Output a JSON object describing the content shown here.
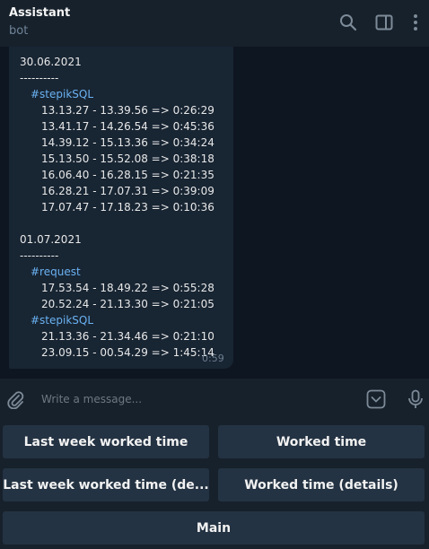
{
  "header": {
    "title": "Assistant",
    "status": "bot",
    "icons": [
      "search-icon",
      "sidebar-toggle-icon",
      "more-vertical-icon"
    ]
  },
  "message": {
    "lines": [
      {
        "text": "30.06.2021",
        "indent": 0,
        "tag": false
      },
      {
        "text": "----------",
        "indent": 0,
        "tag": false
      },
      {
        "text": "#stepikSQL",
        "indent": 1,
        "tag": true
      },
      {
        "text": "13.13.27 - 13.39.56 => 0:26:29",
        "indent": 2,
        "tag": false
      },
      {
        "text": "13.41.17 - 14.26.54 => 0:45:36",
        "indent": 2,
        "tag": false
      },
      {
        "text": "14.39.12 - 15.13.36 => 0:34:24",
        "indent": 2,
        "tag": false
      },
      {
        "text": "15.13.50 - 15.52.08 => 0:38:18",
        "indent": 2,
        "tag": false
      },
      {
        "text": "16.06.40 - 16.28.15 => 0:21:35",
        "indent": 2,
        "tag": false
      },
      {
        "text": "16.28.21 - 17.07.31 => 0:39:09",
        "indent": 2,
        "tag": false
      },
      {
        "text": "17.07.47 - 17.18.23 => 0:10:36",
        "indent": 2,
        "tag": false
      },
      {
        "text": "",
        "indent": 0,
        "tag": false
      },
      {
        "text": "01.07.2021",
        "indent": 0,
        "tag": false
      },
      {
        "text": "----------",
        "indent": 0,
        "tag": false
      },
      {
        "text": "#request",
        "indent": 1,
        "tag": true
      },
      {
        "text": "17.53.54 - 18.49.22 => 0:55:28",
        "indent": 2,
        "tag": false
      },
      {
        "text": "20.52.24 - 21.13.30 => 0:21:05",
        "indent": 2,
        "tag": false
      },
      {
        "text": "#stepikSQL",
        "indent": 1,
        "tag": true
      },
      {
        "text": "21.13.36 - 21.34.46 => 0:21:10",
        "indent": 2,
        "tag": false
      },
      {
        "text": "23.09.15 - 00.54.29 => 1:45:14",
        "indent": 2,
        "tag": false
      }
    ],
    "time": "0:59"
  },
  "composer": {
    "placeholder": "Write a message...",
    "icons": [
      "attach-icon",
      "keyboard-toggle-icon",
      "microphone-icon"
    ]
  },
  "keyboard": {
    "buttons": [
      "Last week worked time",
      "Worked time",
      "Last week worked time (de...",
      "Worked time (details)",
      "Main"
    ]
  },
  "colors": {
    "background": "#0e1621",
    "panel": "#17212b",
    "bubble": "#182533",
    "button": "#243343",
    "hashtag": "#6ab2f2",
    "muted": "#708499"
  }
}
